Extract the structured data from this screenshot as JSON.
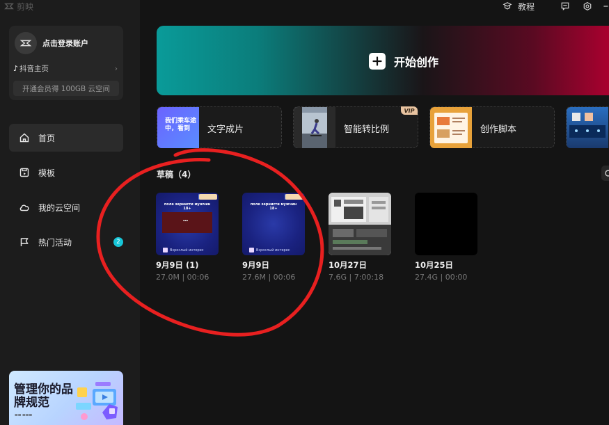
{
  "app": {
    "logo_text": "剪映"
  },
  "topbar": {
    "tutorial_label": "教程"
  },
  "account": {
    "login_text": "点击登录账户",
    "douyin_label": "抖音主页",
    "vip_promo": "开通会员得 100GB 云空间"
  },
  "nav": {
    "items": [
      {
        "label": "首页",
        "icon": "home-icon",
        "active": true
      },
      {
        "label": "模板",
        "icon": "template-icon"
      },
      {
        "label": "我的云空间",
        "icon": "cloud-icon"
      },
      {
        "label": "热门活动",
        "icon": "flag-icon",
        "badge": "2"
      }
    ]
  },
  "brand_banner": {
    "title": "管理你的品牌规范"
  },
  "hero": {
    "label": "开始创作"
  },
  "tools": [
    {
      "label": "文字成片",
      "thumb_text": "我们乘车途中，看到"
    },
    {
      "label": "智能转比例",
      "vip": "VIP"
    },
    {
      "label": "创作脚本"
    },
    {
      "label": ""
    }
  ],
  "drafts": {
    "title": "草稿（4）",
    "items": [
      {
        "name": "9月9日 (1)",
        "meta": "27.0M | 00:06",
        "thumb": "blue-red",
        "header_text": "поле зернисти мужчин 18+",
        "footer_text": "Взрослый интерес"
      },
      {
        "name": "9月9日",
        "meta": "27.6M | 00:06",
        "thumb": "blue",
        "header_text": "поле зернисти мужчин 18+",
        "footer_text": "Взрослый интерес"
      },
      {
        "name": "10月27日",
        "meta": "7.6G | 7:00:18",
        "thumb": "screen"
      },
      {
        "name": "10月25日",
        "meta": "27.4G | 00:00",
        "thumb": "black"
      }
    ]
  },
  "colors": {
    "badge": "#17c6d8",
    "annotation": "#e82020",
    "hero_start": "#0a9b99",
    "hero_end": "#b00030"
  }
}
